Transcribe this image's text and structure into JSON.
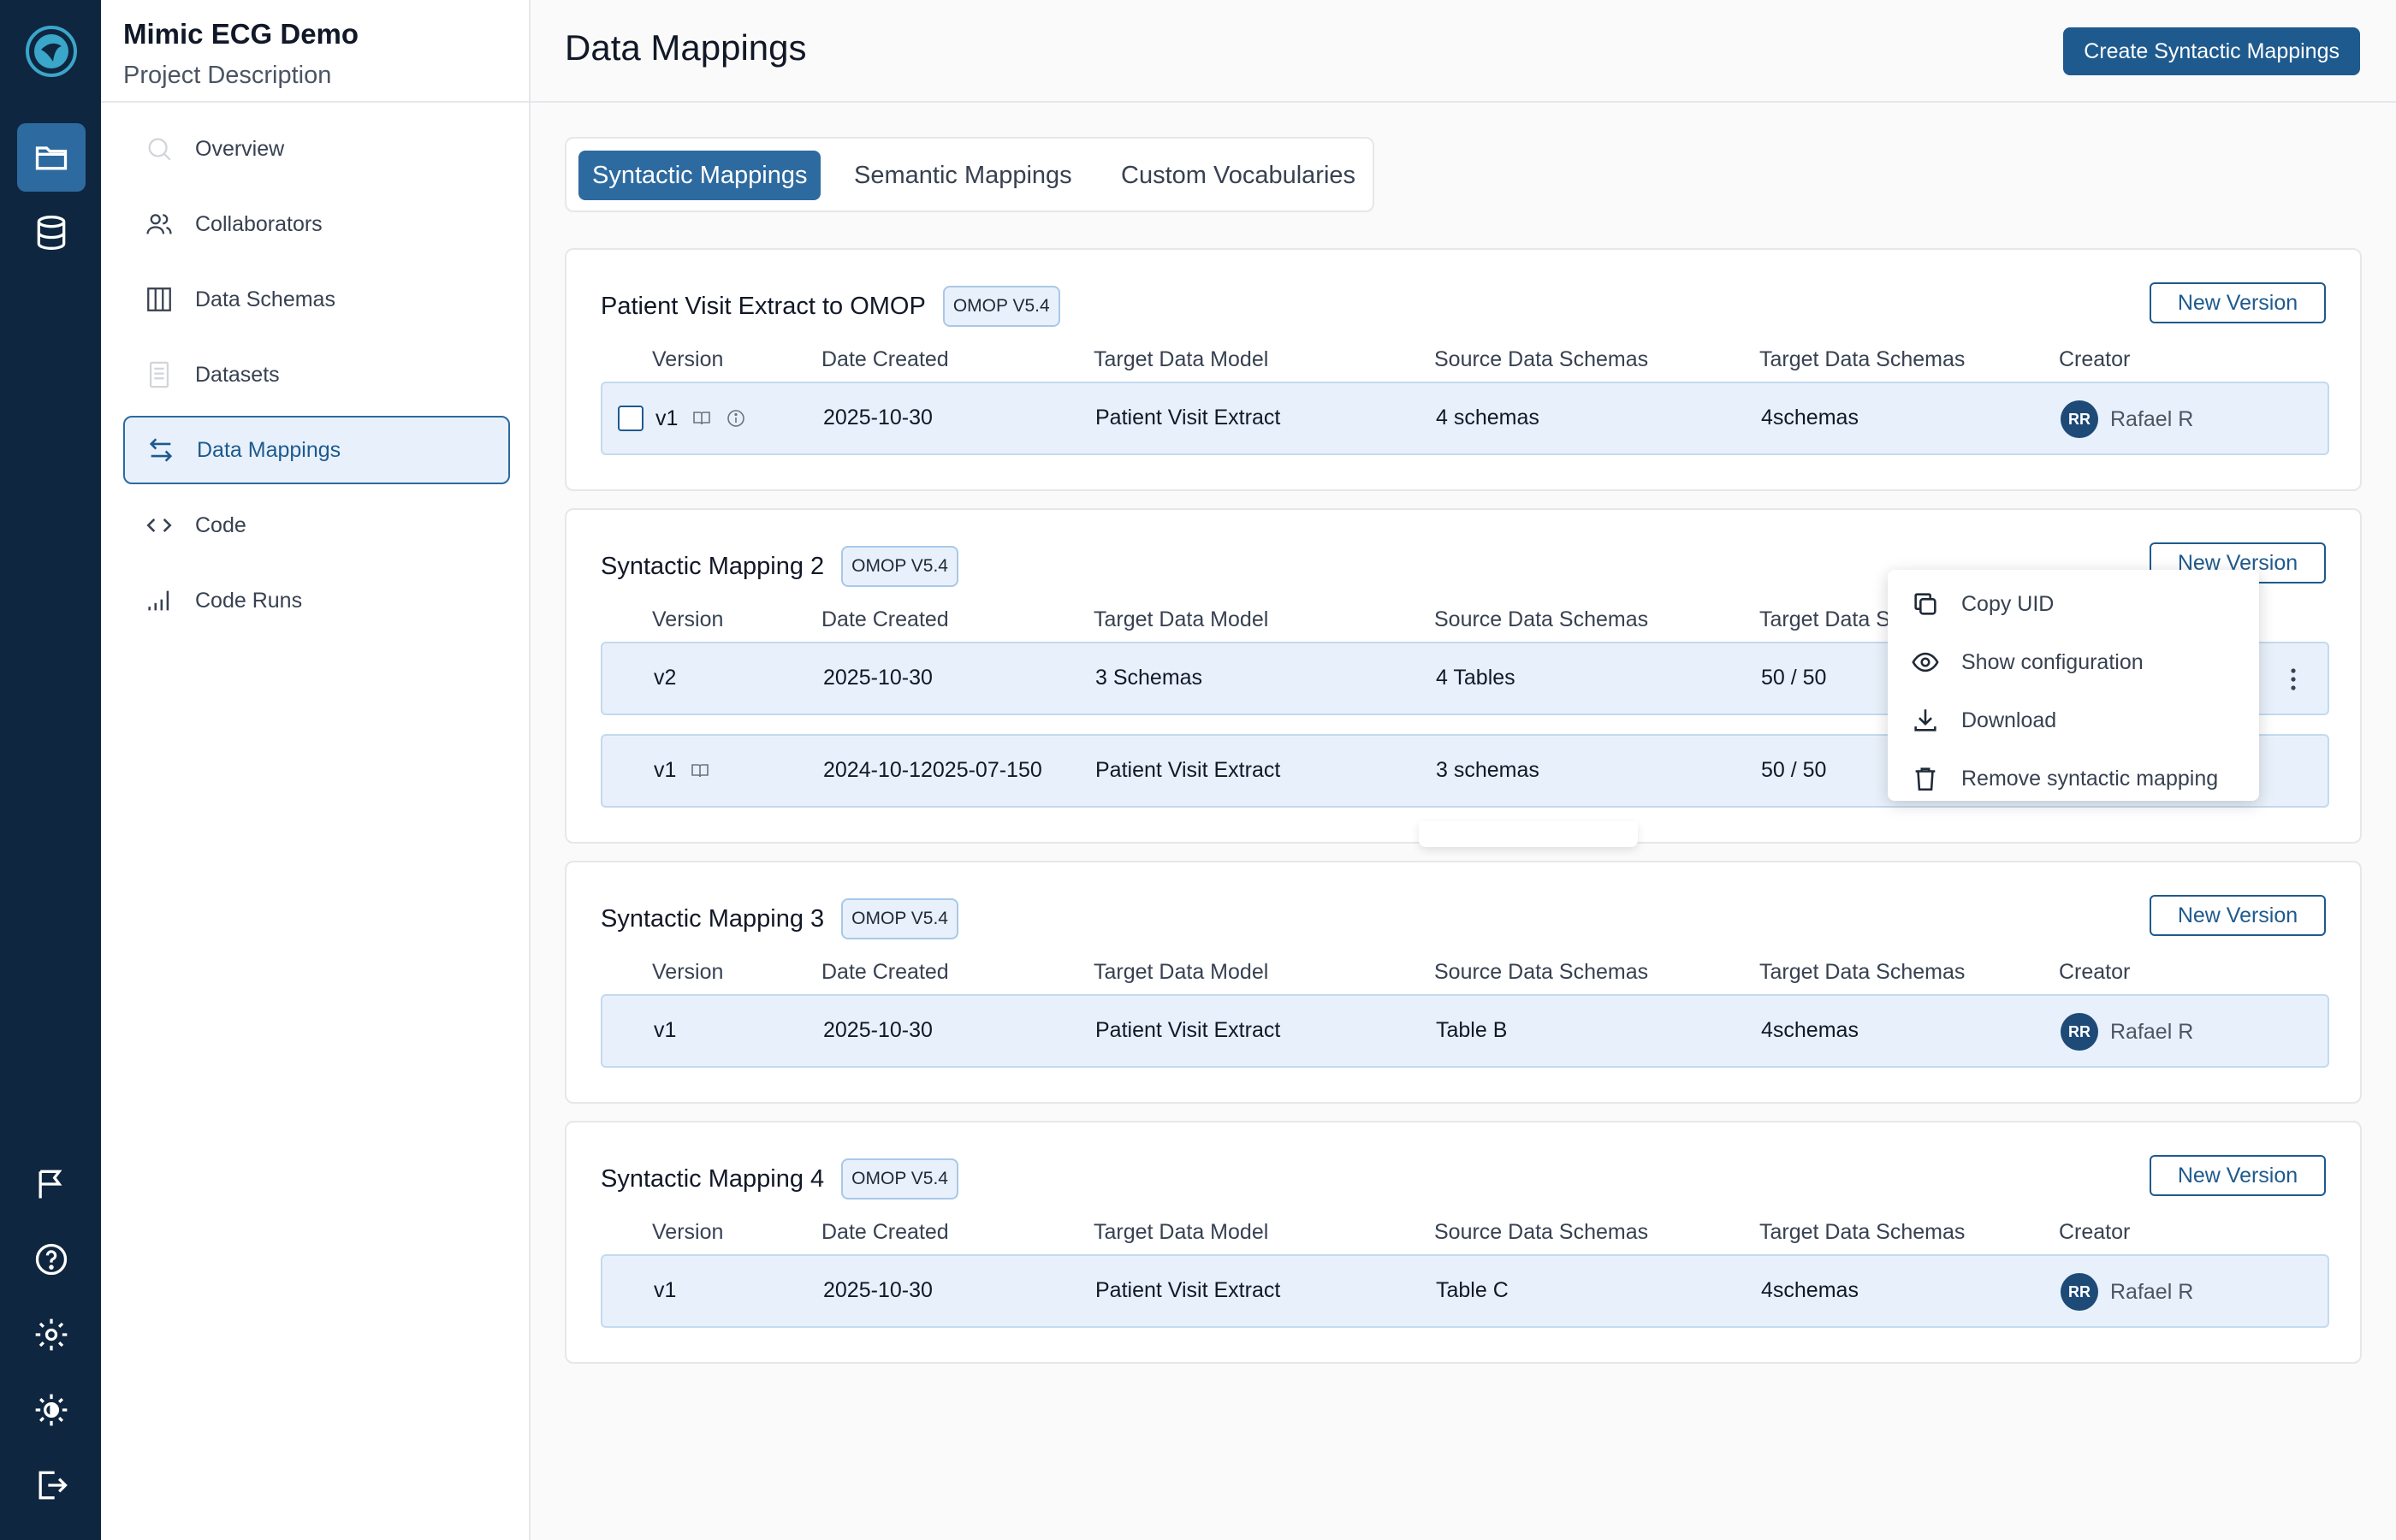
{
  "project": {
    "title": "Mimic ECG Demo",
    "description": "Project Description"
  },
  "sidebar": {
    "items": [
      {
        "label": "Overview"
      },
      {
        "label": "Collaborators"
      },
      {
        "label": "Data Schemas"
      },
      {
        "label": "Datasets"
      },
      {
        "label": "Data Mappings",
        "active": true
      },
      {
        "label": "Code"
      },
      {
        "label": "Code Runs"
      }
    ]
  },
  "header": {
    "title": "Data Mappings",
    "create_button": "Create Syntactic Mappings"
  },
  "tabs": [
    "Syntactic Mappings",
    "Semantic Mappings",
    "Custom Vocabularies"
  ],
  "table_headers": [
    "Version",
    "Date Created",
    "Target Data Model",
    "Source Data Schemas",
    "Target Data Schemas",
    "Creator"
  ],
  "new_version_label": "New Version",
  "cards": [
    {
      "title": "Patient Visit Extract to OMOP",
      "badge": "OMOP V5.4",
      "headers": [
        "Version",
        "Date Created",
        "Target Data Model",
        "Source Data Schemas",
        "Target Data Schemas",
        "Creator"
      ],
      "rows": [
        {
          "version": "v1",
          "date": "2025-10-30",
          "target_model": "Patient Visit Extract",
          "source_schemas": "4 schemas",
          "target_schemas": "4schemas",
          "creator_initials": "RR",
          "creator": "Rafael R"
        }
      ]
    },
    {
      "title": "Syntactic Mapping 2",
      "badge": "OMOP V5.4",
      "headers": [
        "Version",
        "Date Created",
        "Target Data Model",
        "Source Data Schemas",
        "Target Data S"
      ],
      "rows": [
        {
          "version": "v2",
          "date": "2025-10-30",
          "target_model": "3 Schemas",
          "source_schemas": "4 Tables",
          "target_schemas": "50 / 50"
        },
        {
          "version": "v1",
          "date": "2024-10-12025-07-150",
          "target_model": "Patient Visit Extract",
          "source_schemas": "3 schemas",
          "target_schemas": "50 / 50"
        }
      ]
    },
    {
      "title": "Syntactic Mapping 3",
      "badge": "OMOP V5.4",
      "headers": [
        "Version",
        "Date Created",
        "Target Data Model",
        "Source Data Schemas",
        "Target Data Schemas",
        "Creator"
      ],
      "rows": [
        {
          "version": "v1",
          "date": "2025-10-30",
          "target_model": "Patient Visit Extract",
          "source_schemas": "Table B",
          "target_schemas": "4schemas",
          "creator_initials": "RR",
          "creator": "Rafael R"
        }
      ]
    },
    {
      "title": "Syntactic Mapping 4",
      "badge": "OMOP V5.4",
      "headers": [
        "Version",
        "Date Created",
        "Target Data Model",
        "Source Data Schemas",
        "Target Data Schemas",
        "Creator"
      ],
      "rows": [
        {
          "version": "v1",
          "date": "2025-10-30",
          "target_model": "Patient Visit Extract",
          "source_schemas": "Table C",
          "target_schemas": "4schemas",
          "creator_initials": "RR",
          "creator": "Rafael R"
        }
      ]
    }
  ],
  "context_menu": {
    "items": [
      {
        "label": "Copy UID",
        "icon": "copy-icon"
      },
      {
        "label": "Show configuration",
        "icon": "eye-icon"
      },
      {
        "label": "Download",
        "icon": "download-icon"
      },
      {
        "label": "Remove syntactic mapping",
        "icon": "trash-icon"
      }
    ]
  },
  "colors": {
    "rail": "#0f2640",
    "accent": "#1e5a8e",
    "active_tab": "#2d6a9f",
    "row_bg": "#e8f1fb"
  }
}
